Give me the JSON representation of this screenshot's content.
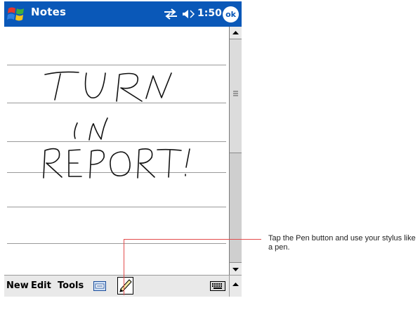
{
  "titlebar": {
    "title": "Notes",
    "time": "1:50",
    "ok_label": "ok",
    "start_icon": "windows-flag-icon",
    "sync_icon": "sync-arrows-icon",
    "volume_icon": "speaker-icon"
  },
  "note": {
    "handwriting_lines": [
      "TURN",
      "IN",
      "REPORT!"
    ]
  },
  "menubar": {
    "items": [
      "New",
      "Edit",
      "Tools"
    ],
    "input_icon": "keyboard-icon",
    "pen_icon": "pen-icon",
    "sip_icon": "keyboard-icon",
    "sip_arrow": "up-arrow-icon"
  },
  "callout": {
    "text": "Tap the Pen button and use your stylus like a pen."
  },
  "colors": {
    "titlebar": "#0a58b8",
    "callout_line": "#e34c4c"
  }
}
